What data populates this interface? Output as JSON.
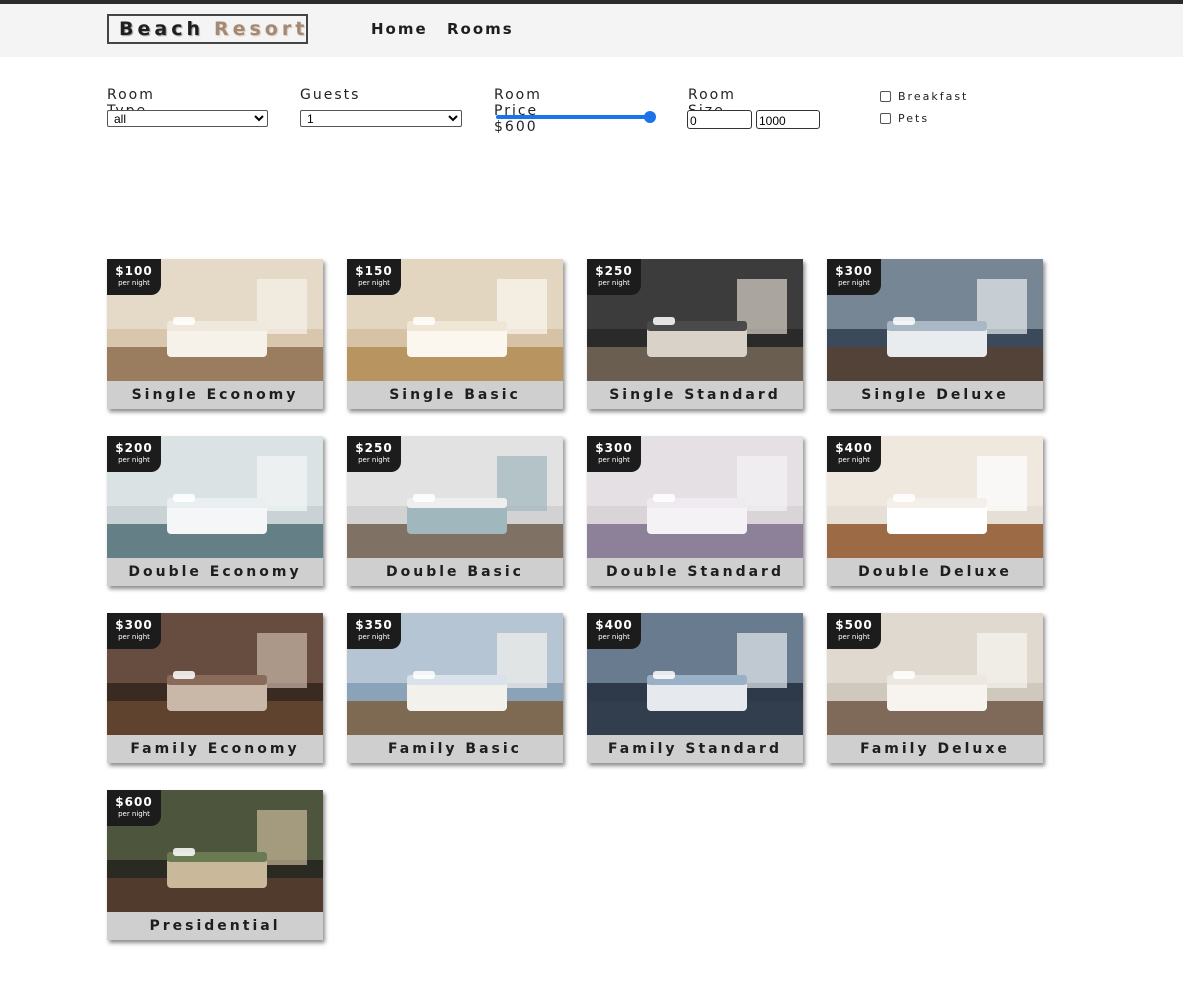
{
  "brand": {
    "word1": "Beach",
    "word2": "Resort"
  },
  "nav": {
    "home": "Home",
    "rooms": "Rooms"
  },
  "filters": {
    "room_type": {
      "label": "Room Type",
      "value": "all"
    },
    "guests": {
      "label": "Guests",
      "value": "1"
    },
    "price": {
      "label": "Room Price $600",
      "value": 600,
      "max": 600
    },
    "size": {
      "label": "Room Size",
      "min": "0",
      "max": "1000"
    },
    "breakfast": {
      "label": "Breakfast",
      "checked": false
    },
    "pets": {
      "label": "Pets",
      "checked": false
    }
  },
  "per_night": "per night",
  "rooms": [
    {
      "name": "Single Economy",
      "price": "$100"
    },
    {
      "name": "Single Basic",
      "price": "$150"
    },
    {
      "name": "Single Standard",
      "price": "$250"
    },
    {
      "name": "Single Deluxe",
      "price": "$300"
    },
    {
      "name": "Double Economy",
      "price": "$200"
    },
    {
      "name": "Double Basic",
      "price": "$250"
    },
    {
      "name": "Double Standard",
      "price": "$300"
    },
    {
      "name": "Double Deluxe",
      "price": "$400"
    },
    {
      "name": "Family Economy",
      "price": "$300"
    },
    {
      "name": "Family Basic",
      "price": "$350"
    },
    {
      "name": "Family Standard",
      "price": "$400"
    },
    {
      "name": "Family Deluxe",
      "price": "$500"
    },
    {
      "name": "Presidential",
      "price": "$600"
    }
  ],
  "colors": {
    "accent": "#1a73e8",
    "card_bg": "#cfcfcf",
    "badge": "#1c1c1c"
  }
}
